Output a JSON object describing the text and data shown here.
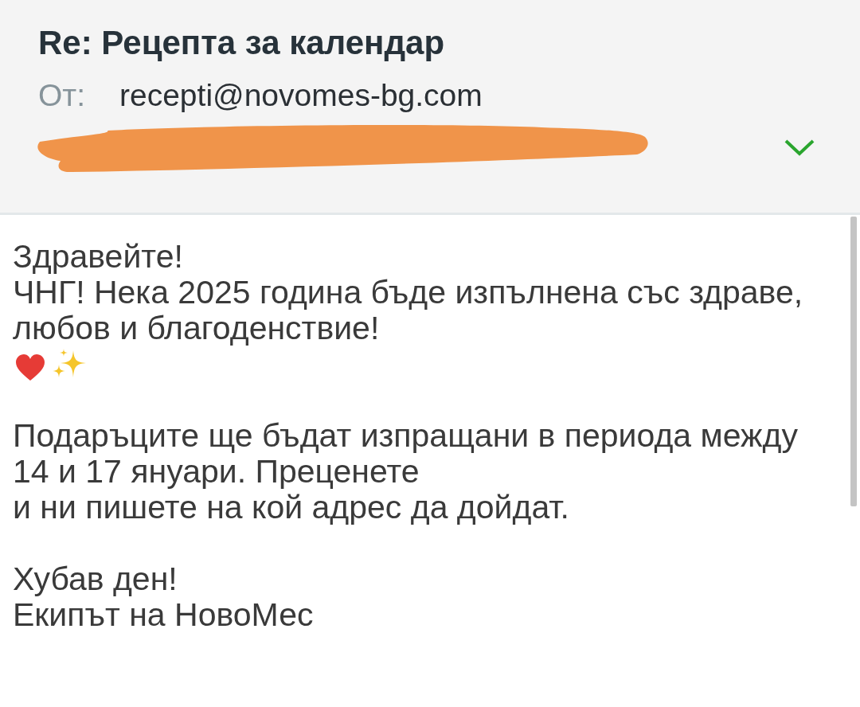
{
  "header": {
    "subject": "Re: Рецепта за календар",
    "from_label": "От:",
    "from_value": "recepti@novomes-bg.com",
    "recipient_redacted": true,
    "expanded": false
  },
  "body": [
    {
      "lines": [
        "Здравейте!",
        "ЧНГ! Нека 2025 година бъде изпълнена със здраве,",
        "любов и благоденствие!"
      ],
      "emoji": true
    },
    {
      "lines": [
        "Подаръците ще бъдат изпращани в периода между",
        "14 и 17 януари. Преценете",
        "и ни пишете на кой адрес да дойдат."
      ],
      "emoji": false
    },
    {
      "lines": [
        "Хубав ден!",
        "Екипът на НовоМес"
      ],
      "emoji": false
    }
  ]
}
